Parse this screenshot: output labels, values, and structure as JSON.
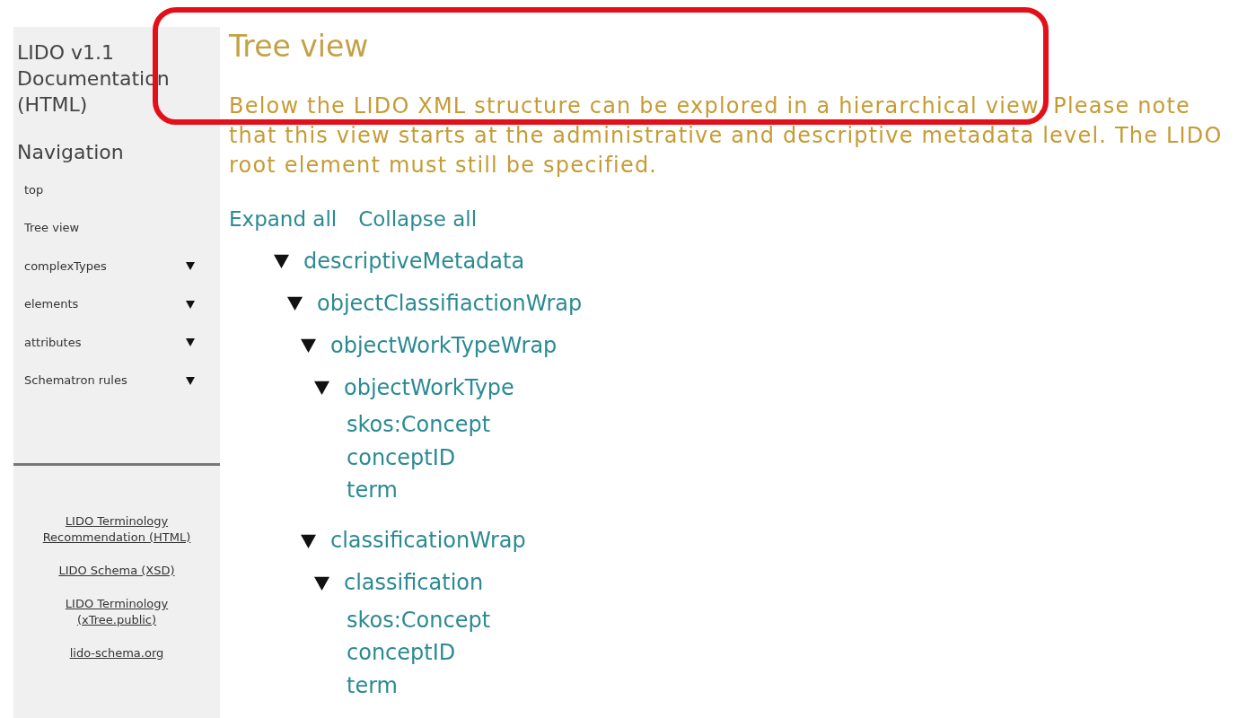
{
  "sidebar": {
    "title": "LIDO v1.1 Documentation (HTML)",
    "nav_heading": "Navigation",
    "items": [
      {
        "label": "top",
        "kind": "link"
      },
      {
        "label": "Tree view",
        "kind": "link"
      },
      {
        "label": "complexTypes",
        "kind": "submenu"
      },
      {
        "label": "elements",
        "kind": "submenu"
      },
      {
        "label": "attributes",
        "kind": "submenu"
      },
      {
        "label": "Schematron rules",
        "kind": "submenu"
      }
    ],
    "links": [
      "LIDO Terminology Recommendation (HTML)",
      "LIDO Schema (XSD)",
      "LIDO Terminology (xTree.public)",
      "lido-schema.org"
    ]
  },
  "main": {
    "title": "Tree view",
    "intro": "Below the LIDO XML structure can be explored in a hierarchical view. Please note that this view starts at the administrative and descriptive metadata level. The LIDO root element must still be specified.",
    "actions": [
      "Expand all",
      "Collapse all"
    ],
    "tree": [
      {
        "label": "descriptiveMetadata",
        "kind": "branch",
        "expanded": true,
        "children": [
          {
            "label": "objectClassifiactionWrap",
            "kind": "branch",
            "expanded": true,
            "children": [
              {
                "label": "objectWorkTypeWrap",
                "kind": "branch",
                "expanded": true,
                "children": [
                  {
                    "label": "objectWorkType",
                    "kind": "branch",
                    "expanded": true,
                    "children": [
                      {
                        "label": "skos:Concept",
                        "kind": "leaf"
                      },
                      {
                        "label": "conceptID",
                        "kind": "leaf"
                      },
                      {
                        "label": "term",
                        "kind": "leaf"
                      }
                    ]
                  }
                ]
              },
              {
                "label": "classificationWrap",
                "kind": "branch",
                "expanded": true,
                "children": [
                  {
                    "label": "classification",
                    "kind": "branch",
                    "expanded": true,
                    "children": [
                      {
                        "label": "skos:Concept",
                        "kind": "leaf"
                      },
                      {
                        "label": "conceptID",
                        "kind": "leaf"
                      },
                      {
                        "label": "term",
                        "kind": "leaf"
                      }
                    ]
                  }
                ]
              }
            ]
          }
        ]
      }
    ]
  },
  "annotation": {
    "kind": "highlight"
  }
}
